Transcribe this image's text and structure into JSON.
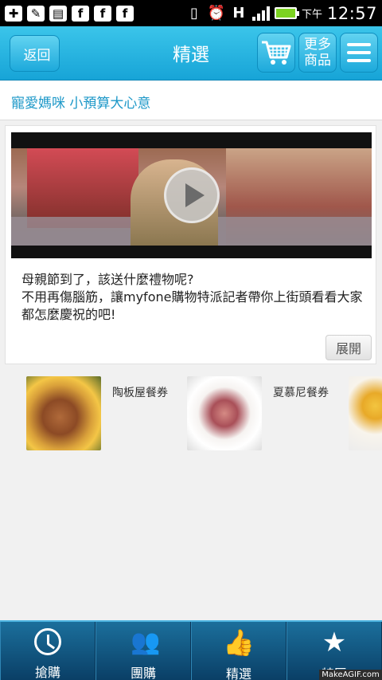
{
  "status_bar": {
    "ampm": "下午",
    "time": "12:57",
    "network": "H",
    "icons": [
      "plus-box-icon",
      "edit-icon",
      "image-icon",
      "facebook-icon",
      "facebook-icon",
      "facebook-icon",
      "vibrate-icon",
      "alarm-icon",
      "network-icon",
      "signal-icon",
      "battery-icon"
    ]
  },
  "header": {
    "back_label": "返回",
    "title": "精選",
    "more_line1": "更多",
    "more_line2": "商品"
  },
  "subtitle": "寵愛媽咪 小預算大心意",
  "video_card": {
    "text_line1": "母親節到了，該送什麼禮物呢?",
    "text_line2": "不用再傷腦筋，讓myfone購物特派記者帶你上街頭看看大家都怎麼慶祝的吧!",
    "expand_label": "展開"
  },
  "products": [
    {
      "name": "陶板屋餐券"
    },
    {
      "name": "夏慕尼餐券"
    }
  ],
  "bottom_nav": [
    {
      "label": "搶購",
      "icon": "clock-icon"
    },
    {
      "label": "團購",
      "icon": "group-icon"
    },
    {
      "label": "精選",
      "icon": "thumbs-up-icon"
    },
    {
      "label": "特區",
      "icon": "star-icon"
    }
  ],
  "watermark": "MakeAGIF.com",
  "colors": {
    "header": "#17a4d7",
    "accent_text": "#1d98c8",
    "nav": "#0a3f66"
  }
}
